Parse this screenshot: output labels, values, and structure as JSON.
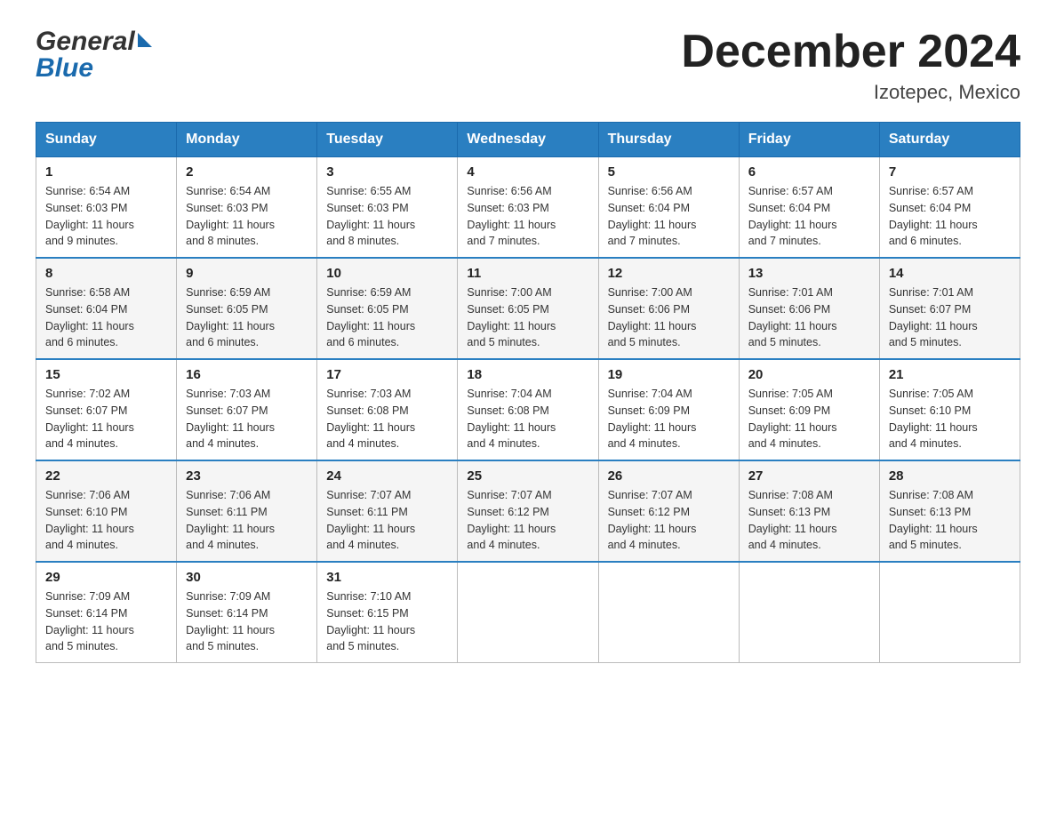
{
  "header": {
    "title": "December 2024",
    "location": "Izotepec, Mexico",
    "logo_general": "General",
    "logo_blue": "Blue"
  },
  "weekdays": [
    "Sunday",
    "Monday",
    "Tuesday",
    "Wednesday",
    "Thursday",
    "Friday",
    "Saturday"
  ],
  "weeks": [
    [
      {
        "day": "1",
        "sunrise": "6:54 AM",
        "sunset": "6:03 PM",
        "daylight": "11 hours and 9 minutes."
      },
      {
        "day": "2",
        "sunrise": "6:54 AM",
        "sunset": "6:03 PM",
        "daylight": "11 hours and 8 minutes."
      },
      {
        "day": "3",
        "sunrise": "6:55 AM",
        "sunset": "6:03 PM",
        "daylight": "11 hours and 8 minutes."
      },
      {
        "day": "4",
        "sunrise": "6:56 AM",
        "sunset": "6:03 PM",
        "daylight": "11 hours and 7 minutes."
      },
      {
        "day": "5",
        "sunrise": "6:56 AM",
        "sunset": "6:04 PM",
        "daylight": "11 hours and 7 minutes."
      },
      {
        "day": "6",
        "sunrise": "6:57 AM",
        "sunset": "6:04 PM",
        "daylight": "11 hours and 7 minutes."
      },
      {
        "day": "7",
        "sunrise": "6:57 AM",
        "sunset": "6:04 PM",
        "daylight": "11 hours and 6 minutes."
      }
    ],
    [
      {
        "day": "8",
        "sunrise": "6:58 AM",
        "sunset": "6:04 PM",
        "daylight": "11 hours and 6 minutes."
      },
      {
        "day": "9",
        "sunrise": "6:59 AM",
        "sunset": "6:05 PM",
        "daylight": "11 hours and 6 minutes."
      },
      {
        "day": "10",
        "sunrise": "6:59 AM",
        "sunset": "6:05 PM",
        "daylight": "11 hours and 6 minutes."
      },
      {
        "day": "11",
        "sunrise": "7:00 AM",
        "sunset": "6:05 PM",
        "daylight": "11 hours and 5 minutes."
      },
      {
        "day": "12",
        "sunrise": "7:00 AM",
        "sunset": "6:06 PM",
        "daylight": "11 hours and 5 minutes."
      },
      {
        "day": "13",
        "sunrise": "7:01 AM",
        "sunset": "6:06 PM",
        "daylight": "11 hours and 5 minutes."
      },
      {
        "day": "14",
        "sunrise": "7:01 AM",
        "sunset": "6:07 PM",
        "daylight": "11 hours and 5 minutes."
      }
    ],
    [
      {
        "day": "15",
        "sunrise": "7:02 AM",
        "sunset": "6:07 PM",
        "daylight": "11 hours and 4 minutes."
      },
      {
        "day": "16",
        "sunrise": "7:03 AM",
        "sunset": "6:07 PM",
        "daylight": "11 hours and 4 minutes."
      },
      {
        "day": "17",
        "sunrise": "7:03 AM",
        "sunset": "6:08 PM",
        "daylight": "11 hours and 4 minutes."
      },
      {
        "day": "18",
        "sunrise": "7:04 AM",
        "sunset": "6:08 PM",
        "daylight": "11 hours and 4 minutes."
      },
      {
        "day": "19",
        "sunrise": "7:04 AM",
        "sunset": "6:09 PM",
        "daylight": "11 hours and 4 minutes."
      },
      {
        "day": "20",
        "sunrise": "7:05 AM",
        "sunset": "6:09 PM",
        "daylight": "11 hours and 4 minutes."
      },
      {
        "day": "21",
        "sunrise": "7:05 AM",
        "sunset": "6:10 PM",
        "daylight": "11 hours and 4 minutes."
      }
    ],
    [
      {
        "day": "22",
        "sunrise": "7:06 AM",
        "sunset": "6:10 PM",
        "daylight": "11 hours and 4 minutes."
      },
      {
        "day": "23",
        "sunrise": "7:06 AM",
        "sunset": "6:11 PM",
        "daylight": "11 hours and 4 minutes."
      },
      {
        "day": "24",
        "sunrise": "7:07 AM",
        "sunset": "6:11 PM",
        "daylight": "11 hours and 4 minutes."
      },
      {
        "day": "25",
        "sunrise": "7:07 AM",
        "sunset": "6:12 PM",
        "daylight": "11 hours and 4 minutes."
      },
      {
        "day": "26",
        "sunrise": "7:07 AM",
        "sunset": "6:12 PM",
        "daylight": "11 hours and 4 minutes."
      },
      {
        "day": "27",
        "sunrise": "7:08 AM",
        "sunset": "6:13 PM",
        "daylight": "11 hours and 4 minutes."
      },
      {
        "day": "28",
        "sunrise": "7:08 AM",
        "sunset": "6:13 PM",
        "daylight": "11 hours and 5 minutes."
      }
    ],
    [
      {
        "day": "29",
        "sunrise": "7:09 AM",
        "sunset": "6:14 PM",
        "daylight": "11 hours and 5 minutes."
      },
      {
        "day": "30",
        "sunrise": "7:09 AM",
        "sunset": "6:14 PM",
        "daylight": "11 hours and 5 minutes."
      },
      {
        "day": "31",
        "sunrise": "7:10 AM",
        "sunset": "6:15 PM",
        "daylight": "11 hours and 5 minutes."
      },
      null,
      null,
      null,
      null
    ]
  ],
  "labels": {
    "sunrise": "Sunrise:",
    "sunset": "Sunset:",
    "daylight": "Daylight:"
  }
}
